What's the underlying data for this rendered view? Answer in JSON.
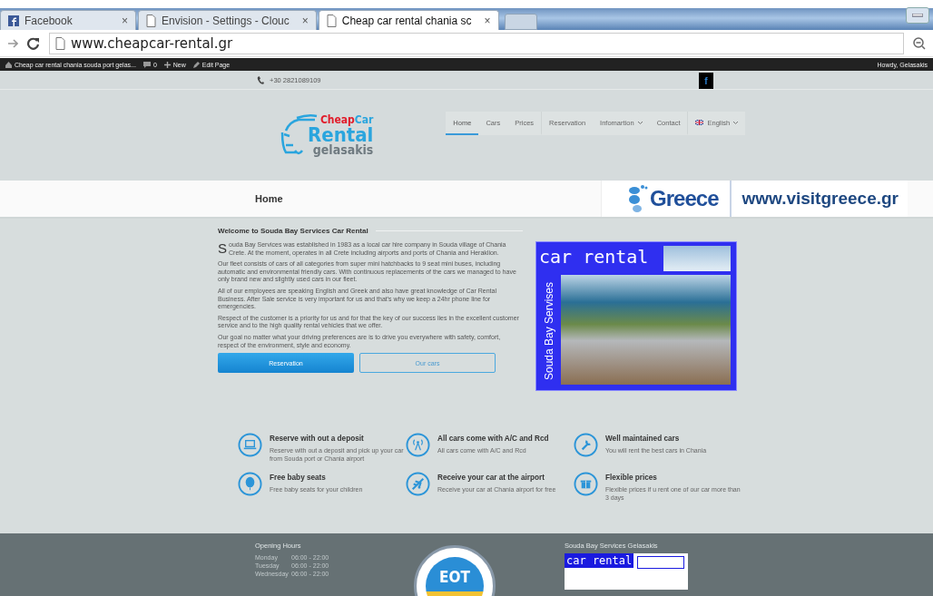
{
  "browser": {
    "tabs": [
      {
        "title": "Facebook",
        "kind": "facebook",
        "selected": false
      },
      {
        "title": "Envision - Settings - Clouc",
        "kind": "page",
        "selected": false
      },
      {
        "title": "Cheap car rental chania sc",
        "kind": "page",
        "selected": true
      }
    ],
    "close_glyph": "×",
    "address": "www.cheapcar-rental.gr"
  },
  "admin_bar": {
    "site": "Cheap car rental chania souda port gelas...",
    "comments": "0",
    "new": "New",
    "edit": "Edit Page",
    "greeting": "Howdy, Gelasakis"
  },
  "top_strip": {
    "phone": "+30 2821089109",
    "social": "f"
  },
  "logo": {
    "line_1a": "Cheap",
    "line_1b": "Car",
    "line_2": "Rental",
    "line_3": "gelasakis"
  },
  "nav": [
    {
      "label": "Home",
      "kind": "link",
      "selected": true
    },
    {
      "label": "Cars",
      "kind": "link",
      "selected": false
    },
    {
      "label": "Prices",
      "kind": "link",
      "selected": false
    },
    {
      "label": "Reservation",
      "kind": "link",
      "selected": false
    },
    {
      "label": "Infomartion",
      "kind": "dropdown",
      "selected": false
    },
    {
      "label": "Contact",
      "kind": "link",
      "selected": false
    },
    {
      "label": "English",
      "kind": "language",
      "selected": false
    }
  ],
  "title_bar": {
    "title": "Home",
    "banner_name": "Greece",
    "banner_url": "www.visitgreece.gr"
  },
  "content": {
    "heading": "Welcome to Souda Bay Services Car Rental",
    "drop_cap": "S",
    "paragraphs": [
      "ouda Bay Services was established in 1983 as a local car hire company in Souda village of Chania Crete. At the moment, operates in all Crete including airports and ports of Chania and Heraklion.",
      "Our fleet consists of cars of all categories from super mini hatchbacks to 9 seat mini buses, including automatic and environmental friendly cars. With continuous replacements of the cars we managed to have only brand new and slightly used cars in our fleet.",
      "All of our employees are speaking English and Greek and also have great knowledge of Car Rental Business. After Sale service is very important for us and that's why we keep a 24hr phone line for emergencies.",
      "Respect of the customer is a priority for us and for that the key of our success lies in the excellent customer service and to the high quality rental vehicles that we offer.",
      "Our goal no matter what your driving preferences are is to drive you everywhere with safety, comfort, respect of the environment, style and economy."
    ],
    "buttons": [
      {
        "label": "Reservation",
        "kind": "primary"
      },
      {
        "label": "Our cars",
        "kind": "outline"
      }
    ],
    "image": {
      "title": "car rental",
      "side_text": "Souda Bay Servises"
    }
  },
  "features": [
    {
      "kind": "laptop",
      "title": "Reserve with out a deposit",
      "text": "Reserve with out a deposit and pick up your car from Souda port or Chania airport"
    },
    {
      "kind": "antenna",
      "title": "All cars come with A/C and Rcd",
      "text": "All cars come with A/C and Rcd"
    },
    {
      "kind": "wrench",
      "title": "Well maintained cars",
      "text": "You will rent the best cars in Chania"
    },
    {
      "kind": "balloon",
      "title": "Free baby seats",
      "text": "Free baby seats for your children"
    },
    {
      "kind": "plane",
      "title": "Receive your car at the airport",
      "text": "Receive your car at Chania airport for free"
    },
    {
      "kind": "gift",
      "title": "Flexible prices",
      "text": "Flexible prices if u rent one of our car more than 3 days"
    }
  ],
  "footer": {
    "hours_title": "Opening Hours",
    "hours": [
      {
        "day": "Monday",
        "time": "06:00 - 22:00"
      },
      {
        "day": "Tuesday",
        "time": "06:00 - 22:00"
      },
      {
        "day": "Wednesday",
        "time": "06:00 - 22:00"
      }
    ],
    "badge": "EOT",
    "company": "Souda Bay Services Gelasakis",
    "card_title": "car rental"
  }
}
